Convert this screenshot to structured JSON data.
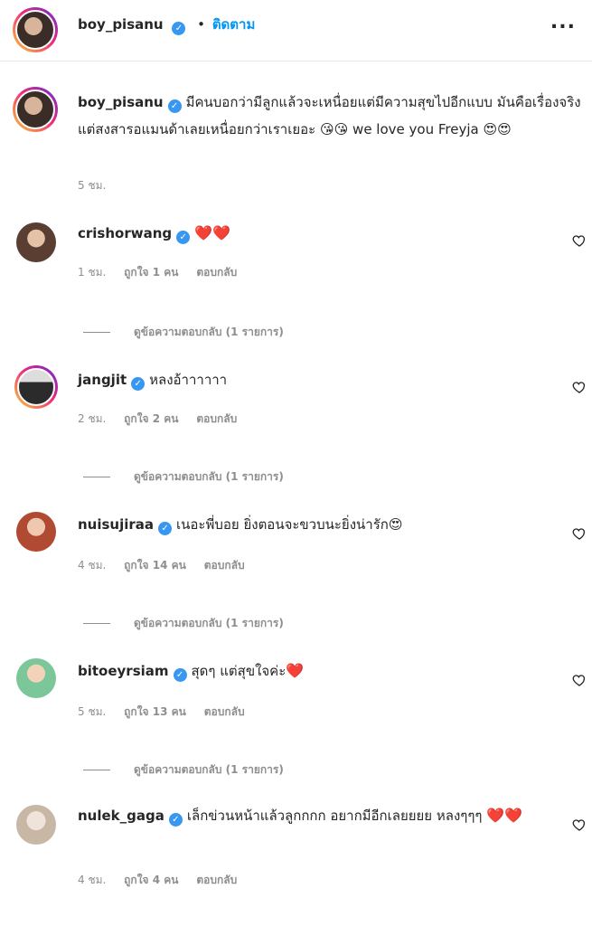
{
  "header": {
    "username": "boy_pisanu",
    "separator": "•",
    "follow_label": "ติดตาม",
    "more": "..."
  },
  "caption": {
    "username": "boy_pisanu",
    "text": "มีคนบอกว่ามีลูกแล้วจะเหนื่อยแต่มีความสุขไปอีกแบบ มันคือเรื่องจริง แต่สงสารอแมนด้าเลยเหนื่อยกว่าเราเยอะ",
    "emojis_1": "😘😘",
    "text2": "we love you Freyja",
    "emojis_2": "😍😍",
    "time": "5 ชม."
  },
  "comments": [
    {
      "username": "crishorwang",
      "text": "",
      "hearts": "❤️❤️",
      "time": "1 ชม.",
      "likes": "ถูกใจ 1 คน",
      "reply": "ตอบกลับ",
      "view_replies": "ดูข้อความตอบกลับ (1 รายการ)"
    },
    {
      "username": "jangjit",
      "text": "หลงอ้าาาาาา",
      "hearts": "",
      "time": "2 ชม.",
      "likes": "ถูกใจ 2 คน",
      "reply": "ตอบกลับ",
      "view_replies": "ดูข้อความตอบกลับ (1 รายการ)"
    },
    {
      "username": "nuisujiraa",
      "text": "เนอะพี่บอย ยิ่งตอนจะขวบนะยิ่งน่ารัก",
      "hearts": "😍",
      "time": "4 ชม.",
      "likes": "ถูกใจ 14 คน",
      "reply": "ตอบกลับ",
      "view_replies": "ดูข้อความตอบกลับ (1 รายการ)"
    },
    {
      "username": "bitoeyrsiam",
      "text": "สุดๆ แต่สุขใจค่ะ",
      "hearts": "❤️",
      "time": "5 ชม.",
      "likes": "ถูกใจ 13 คน",
      "reply": "ตอบกลับ",
      "view_replies": "ดูข้อความตอบกลับ (1 รายการ)"
    },
    {
      "username": "nulek_gaga",
      "text": "เล็กข่วนหน้าแล้วลูกกกก อยากมีอีกเลยยยย หลงๆๆๆ",
      "hearts": "❤️❤️",
      "time": "4 ชม.",
      "likes": "ถูกใจ 4 คน",
      "reply": "ตอบกลับ",
      "view_replies": ""
    }
  ],
  "colors": {
    "link": "#0095f6",
    "verified": "#3897f0",
    "muted": "#8e8e8e"
  }
}
